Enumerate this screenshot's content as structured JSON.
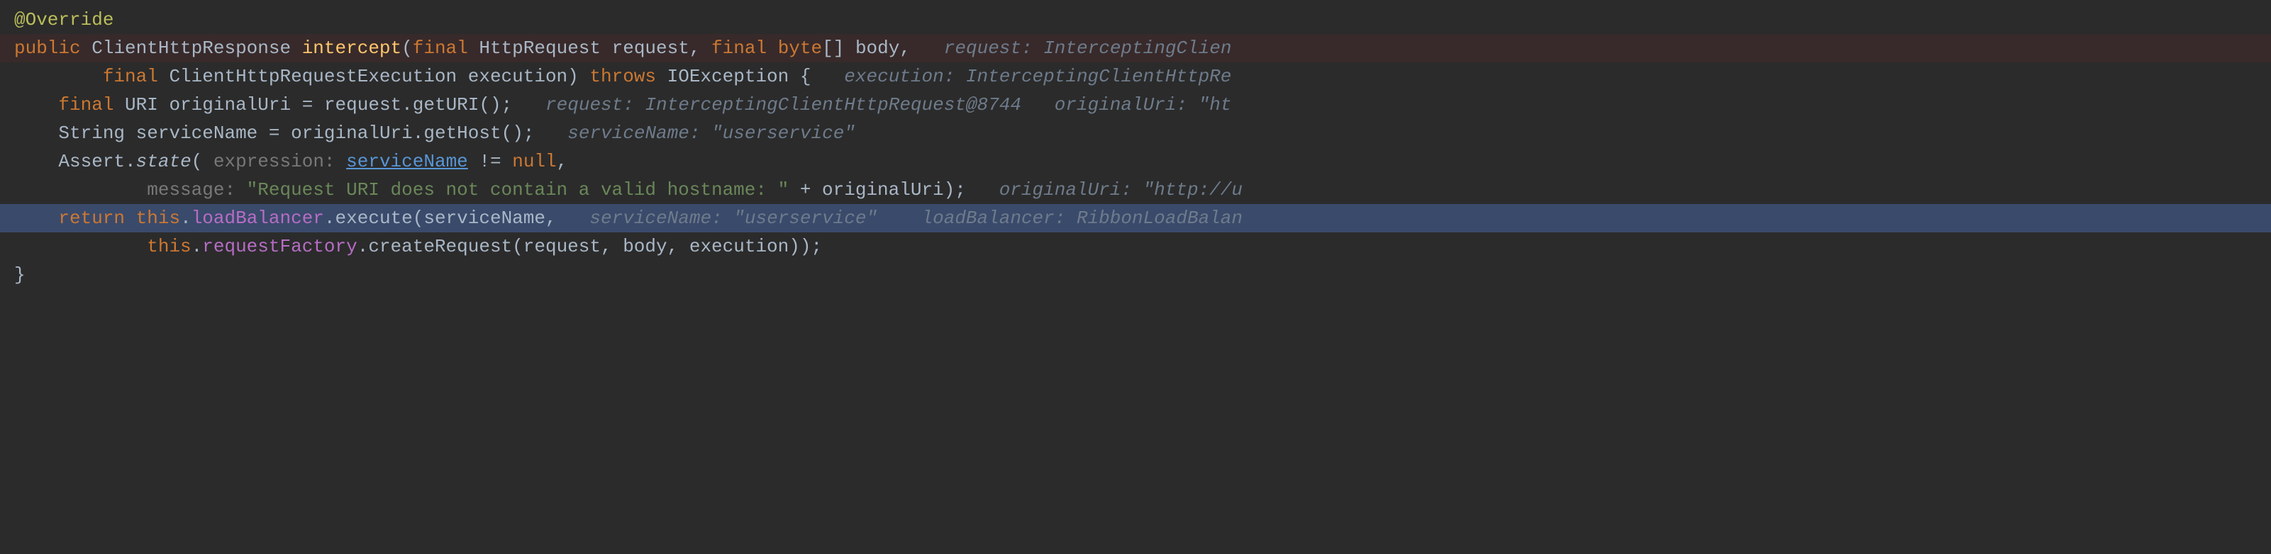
{
  "code": {
    "annotation": "@Override",
    "kw_public": "public",
    "type_response": "ClientHttpResponse",
    "method_name": "intercept",
    "kw_final1": "final",
    "type_req": "HttpRequest",
    "param_request": "request",
    "kw_final2": "final",
    "type_byte": "byte",
    "brackets": "[]",
    "param_body": "body",
    "kw_final3": "final",
    "type_exec": "ClientHttpRequestExecution",
    "param_execution": "execution",
    "kw_throws": "throws",
    "type_ioexception": "IOException",
    "brace_open": "{",
    "kw_final4": "final",
    "type_uri": "URI",
    "var_originalUri": "originalUri",
    "eq": "=",
    "call_request": "request",
    "dot1": ".",
    "call_getURI": "getURI",
    "parens_empty": "()",
    "semi": ";",
    "type_string": "String",
    "var_serviceName": "serviceName",
    "call_originalUri": "originalUri",
    "call_getHost": "getHost",
    "class_Assert": "Assert",
    "m_state": "state",
    "label_expression": "expression:",
    "link_serviceName": "serviceName",
    "op_ne": "!=",
    "kw_null": "null",
    "comma": ",",
    "label_message": "message:",
    "str_msg": "\"Request URI does not contain a valid hostname: \"",
    "op_plus": "+",
    "var_originalUri2": "originalUri",
    "kw_return": "return",
    "kw_this": "this",
    "field_loadBalancer": "loadBalancer",
    "m_execute": "execute",
    "arg_serviceName": "serviceName",
    "field_requestFactory": "requestFactory",
    "m_createRequest": "createRequest",
    "arg_request": "request",
    "arg_body": "body",
    "arg_execution": "execution",
    "close_parens": "))",
    "brace_close": "}"
  },
  "hints": {
    "h_request_sig": "request: InterceptingClien",
    "h_execution_sig": "execution: InterceptingClientHttpRe",
    "h_request_uri": "request: InterceptingClientHttpRequest@8744",
    "h_originalUri_uri": "originalUri: \"ht",
    "h_serviceName": "serviceName: \"userservice\"",
    "h_originalUri_msg": "originalUri: \"http://u",
    "h_serviceName_exec": "serviceName: \"userservice\"",
    "h_loadBalancer": "loadBalancer: RibbonLoadBalan"
  }
}
